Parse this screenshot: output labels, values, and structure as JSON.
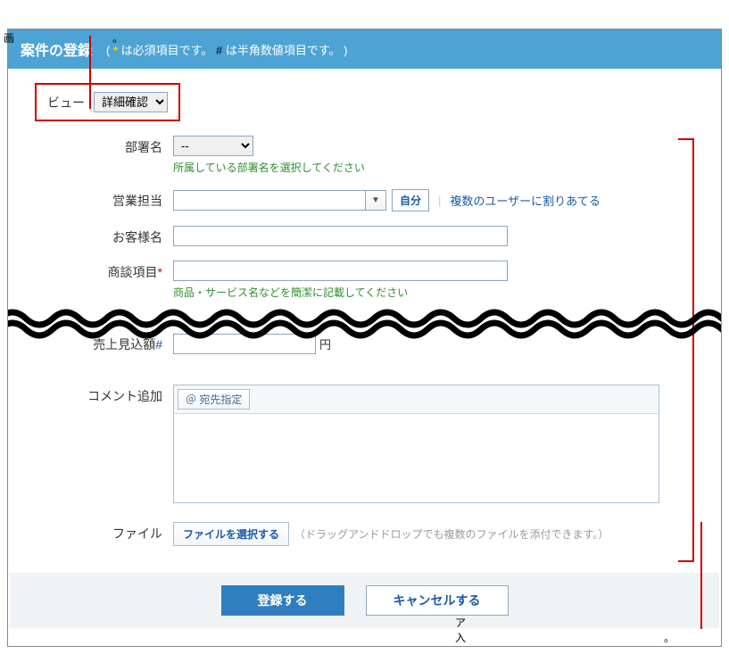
{
  "top_annotation_prefix": "画",
  "top_annotation_suffix": "。",
  "bottom_annotation_line1_prefix": "ア",
  "bottom_annotation_line2_prefix": "入",
  "bottom_annotation_suffix": "。",
  "header": {
    "title": "案件の登録",
    "note_open": "( ",
    "req_mark": "*",
    "note_req": " は必須項目です。 ",
    "num_mark": "#",
    "note_num": " は半角数値項目です。 )"
  },
  "view": {
    "label": "ビュー",
    "selected": "詳細確認"
  },
  "fields": {
    "department": {
      "label": "部署名",
      "value": "--",
      "hint": "所属している部署名を選択してください"
    },
    "owner": {
      "label": "営業担当",
      "self_btn": "自分",
      "pipe": "|",
      "multi_link": "複数のユーザーに割りあてる"
    },
    "customer": {
      "label": "お客様名"
    },
    "deal": {
      "label": "商談項目",
      "mark": "*",
      "hint": "商品・サービス名などを簡潔に記載してください"
    },
    "sales": {
      "label": "売上見込額",
      "mark": "#",
      "unit": "円"
    },
    "comment": {
      "label": "コメント追加",
      "mention": "＠ 宛先指定"
    },
    "file": {
      "label": "ファイル",
      "button": "ファイルを選択する",
      "note": "（ドラッグアンドドロップでも複数のファイルを添付できます。）"
    }
  },
  "actions": {
    "submit": "登録する",
    "cancel": "キャンセルする"
  }
}
